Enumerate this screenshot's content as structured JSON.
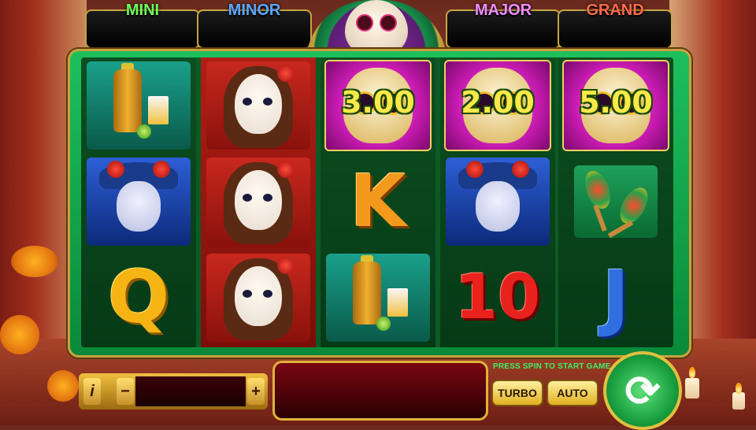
{
  "jackpots": [
    {
      "label": "MINI",
      "value": "",
      "color": "#6bff5a"
    },
    {
      "label": "MINOR",
      "value": "",
      "color": "#5aa8ff"
    },
    {
      "label": "MAJOR",
      "value": "",
      "color": "#f08cff"
    },
    {
      "label": "GRAND",
      "value": "",
      "color": "#ff6a4a"
    }
  ],
  "reels": [
    [
      "tequila",
      "calavera-man",
      "Q"
    ],
    [
      "catrina-woman",
      "catrina-woman",
      "catrina-woman"
    ],
    [
      "skull-3.00",
      "K",
      "tequila"
    ],
    [
      "skull-2.00",
      "calavera-man",
      "10"
    ],
    [
      "skull-5.00",
      "maracas",
      "J"
    ]
  ],
  "skull_values": {
    "reel3": "3.00",
    "reel4": "2.00",
    "reel5": "5.00"
  },
  "letters": {
    "Q": "Q",
    "K": "K",
    "ten": "10",
    "J": "J"
  },
  "controls": {
    "info_label": "i",
    "minus_label": "−",
    "plus_label": "+",
    "bet_value": "",
    "turbo_label": "TURBO",
    "auto_label": "AUTO",
    "press_spin": "PRESS SPIN TO START GAME",
    "spin_symbol": "⟳"
  }
}
